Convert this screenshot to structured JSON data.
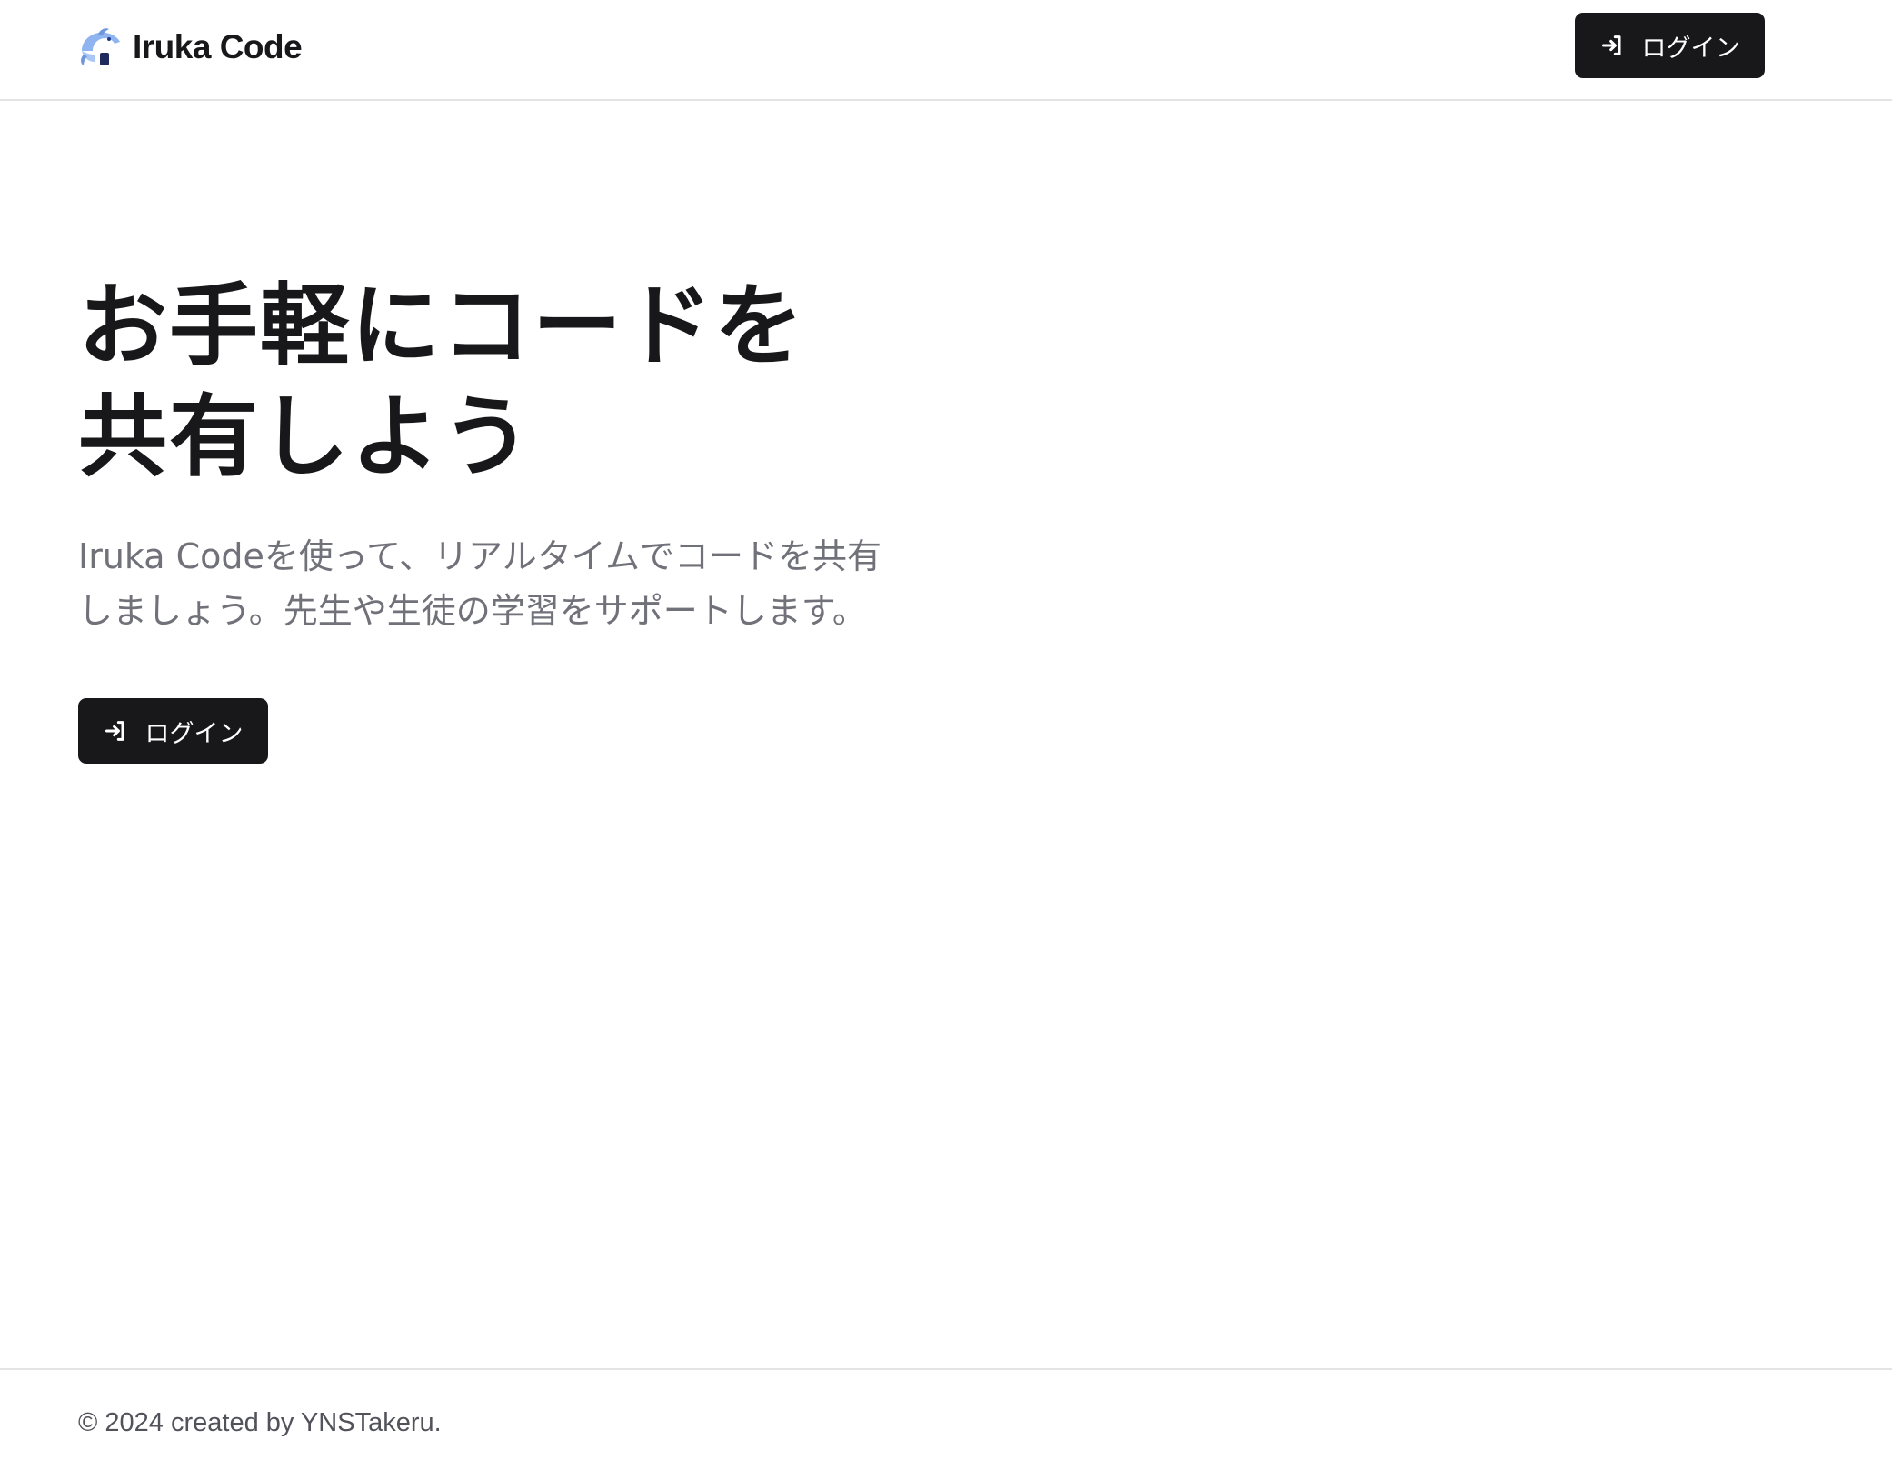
{
  "header": {
    "brand_name": "Iruka Code",
    "logo_icon": "dolphin-icon",
    "login_label": "ログイン",
    "login_icon": "login-arrow-icon"
  },
  "hero": {
    "title_line1": "お手軽にコードを",
    "title_line2": "共有しよう",
    "subtitle_line1": "Iruka Codeを使って、リアルタイムでコードを共有",
    "subtitle_line2": "しましょう。先生や生徒の学習をサポートします。",
    "login_label": "ログイン",
    "login_icon": "login-arrow-icon"
  },
  "footer": {
    "copyright": "© 2024 created by YNSTakeru."
  },
  "colors": {
    "primary": "#18181b",
    "muted_text": "#71717a",
    "border": "#e4e4e7",
    "logo_blue": "#8fb4ef"
  }
}
